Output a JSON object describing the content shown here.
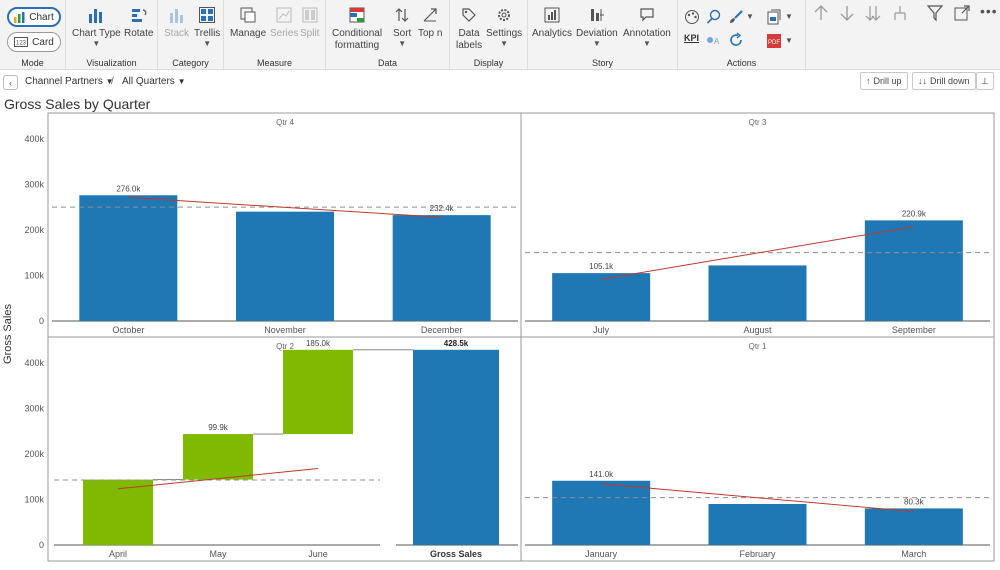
{
  "ribbon": {
    "mode": {
      "label": "Mode",
      "chart": "Chart",
      "card": "Card"
    },
    "visualization": {
      "label": "Visualization",
      "chart_type": "Chart Type",
      "rotate": "Rotate"
    },
    "category": {
      "label": "Category",
      "stack": "Stack",
      "trellis": "Trellis"
    },
    "measure": {
      "label": "Measure",
      "manage": "Manage",
      "series": "Series",
      "split": "Split"
    },
    "data": {
      "label": "Data",
      "conditional_l1": "Conditional",
      "conditional_l2": "formatting",
      "sort": "Sort",
      "top_n": "Top n"
    },
    "display": {
      "label": "Display",
      "data_l1": "Data",
      "data_l2": "labels",
      "settings": "Settings"
    },
    "story": {
      "label": "Story",
      "analytics": "Analytics",
      "deviation": "Deviation",
      "annotation": "Annotation"
    },
    "actions": {
      "label": "Actions",
      "kpi": "KPI"
    }
  },
  "breadcrumb": {
    "level1": "Channel Partners",
    "level2": "All Quarters"
  },
  "drill": {
    "up": "Drill up",
    "down": "Drill down"
  },
  "chart_data": {
    "type": "bar",
    "title": "Gross Sales by Quarter",
    "ylabel": "Gross Sales",
    "ylim": [
      0,
      450000
    ],
    "yticks": [
      "0",
      "100k",
      "200k",
      "300k",
      "400k"
    ],
    "colors": {
      "bar": "#1f77b4",
      "increase": "#7fba00",
      "trend": "#c0392b",
      "average": "#8f8f8f"
    },
    "panels": [
      {
        "title": "Qtr 4",
        "kind": "bar",
        "categories": [
          "October",
          "November",
          "December"
        ],
        "values": [
          276000,
          240000,
          232400
        ],
        "labels": [
          "276.0k",
          "",
          "232.4k"
        ],
        "average": 250000
      },
      {
        "title": "Qtr 3",
        "kind": "bar",
        "categories": [
          "July",
          "August",
          "September"
        ],
        "values": [
          105100,
          122000,
          220900
        ],
        "labels": [
          "105.1k",
          "",
          "220.9k"
        ],
        "average": 150000
      },
      {
        "title": "Qtr 2",
        "kind": "waterfall",
        "categories": [
          "April",
          "May",
          "June",
          "Gross Sales"
        ],
        "values": [
          143600,
          99900,
          185000,
          428500
        ],
        "labels": [
          "",
          "99.9k",
          "185.0k",
          "428.5k"
        ],
        "average": 142800
      },
      {
        "title": "Qtr 1",
        "kind": "bar",
        "categories": [
          "January",
          "February",
          "March"
        ],
        "values": [
          141000,
          90000,
          80300
        ],
        "labels": [
          "141.0k",
          "",
          "80.3k"
        ],
        "average": 104000
      }
    ]
  }
}
